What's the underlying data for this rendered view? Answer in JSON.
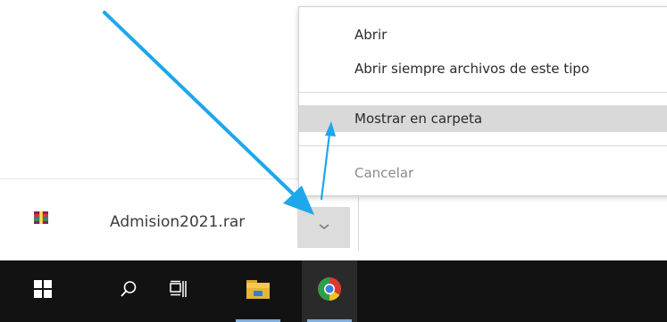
{
  "download": {
    "file_name": "Admision2021.rar"
  },
  "context_menu": {
    "items": [
      {
        "label": "Abrir",
        "state": "normal"
      },
      {
        "label": "Abrir siempre archivos de este tipo",
        "state": "normal"
      },
      {
        "label": "Mostrar en carpeta",
        "state": "hovered"
      },
      {
        "label": "Cancelar",
        "state": "disabled"
      }
    ]
  },
  "taskbar": {
    "items": [
      {
        "icon": "windows-start-icon"
      },
      {
        "icon": "search-icon"
      },
      {
        "icon": "task-view-icon"
      },
      {
        "icon": "file-explorer-icon"
      },
      {
        "icon": "chrome-icon",
        "active": true
      }
    ]
  },
  "colors": {
    "annotation_arrow": "#1ea7ea",
    "menu_hover": "#d9d9d9",
    "taskbar": "#121212"
  }
}
